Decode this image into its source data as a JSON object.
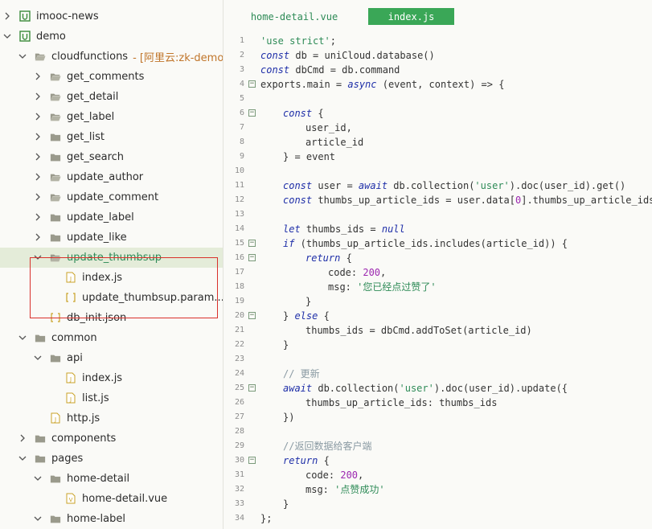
{
  "tree": {
    "rows": [
      {
        "label": "imooc-news",
        "depth": 0,
        "chevron": "right",
        "icon": "project"
      },
      {
        "label": "demo",
        "depth": 0,
        "chevron": "down",
        "icon": "project"
      },
      {
        "label": "cloudfunctions",
        "depth": 1,
        "chevron": "down",
        "icon": "folder-open",
        "suffix": "- [阿里云:zk-demo]"
      },
      {
        "label": "get_comments",
        "depth": 2,
        "chevron": "right",
        "icon": "folder-open"
      },
      {
        "label": "get_detail",
        "depth": 2,
        "chevron": "right",
        "icon": "folder-open"
      },
      {
        "label": "get_label",
        "depth": 2,
        "chevron": "right",
        "icon": "folder-open"
      },
      {
        "label": "get_list",
        "depth": 2,
        "chevron": "right",
        "icon": "folder"
      },
      {
        "label": "get_search",
        "depth": 2,
        "chevron": "right",
        "icon": "folder"
      },
      {
        "label": "update_author",
        "depth": 2,
        "chevron": "right",
        "icon": "folder-open"
      },
      {
        "label": "update_comment",
        "depth": 2,
        "chevron": "right",
        "icon": "folder-open"
      },
      {
        "label": "update_label",
        "depth": 2,
        "chevron": "right",
        "icon": "folder"
      },
      {
        "label": "update_like",
        "depth": 2,
        "chevron": "right",
        "icon": "folder"
      },
      {
        "label": "update_thumbsup",
        "depth": 2,
        "chevron": "down",
        "icon": "folder-open",
        "selected": true
      },
      {
        "label": "index.js",
        "depth": 3,
        "chevron": "none",
        "icon": "js-file"
      },
      {
        "label": "update_thumbsup.param....",
        "depth": 3,
        "chevron": "none",
        "icon": "json-file"
      },
      {
        "label": "db_init.json",
        "depth": 2,
        "chevron": "none",
        "icon": "json-file"
      },
      {
        "label": "common",
        "depth": 1,
        "chevron": "down",
        "icon": "folder"
      },
      {
        "label": "api",
        "depth": 2,
        "chevron": "down",
        "icon": "folder"
      },
      {
        "label": "index.js",
        "depth": 3,
        "chevron": "none",
        "icon": "js-file"
      },
      {
        "label": "list.js",
        "depth": 3,
        "chevron": "none",
        "icon": "js-file"
      },
      {
        "label": "http.js",
        "depth": 2,
        "chevron": "none",
        "icon": "js-file"
      },
      {
        "label": "components",
        "depth": 1,
        "chevron": "right",
        "icon": "folder"
      },
      {
        "label": "pages",
        "depth": 1,
        "chevron": "down",
        "icon": "folder"
      },
      {
        "label": "home-detail",
        "depth": 2,
        "chevron": "down",
        "icon": "folder"
      },
      {
        "label": "home-detail.vue",
        "depth": 3,
        "chevron": "none",
        "icon": "vue-file"
      },
      {
        "label": "home-label",
        "depth": 2,
        "chevron": "down",
        "icon": "folder"
      }
    ]
  },
  "tabs": [
    {
      "label": "home-detail.vue",
      "active": false
    },
    {
      "label": "index.js",
      "active": true
    }
  ],
  "colors": {
    "accent": "#3aa757",
    "highlight": "#d9302b",
    "selection": "#e4ecd9"
  },
  "code": [
    {
      "n": "1",
      "fold": false,
      "indent": 0,
      "tokens": [
        [
          "str",
          "'use strict'"
        ],
        [
          "p",
          ";"
        ]
      ]
    },
    {
      "n": "2",
      "fold": false,
      "indent": 0,
      "tokens": [
        [
          "kw",
          "const"
        ],
        [
          "p",
          " db = uniCloud.database()"
        ]
      ]
    },
    {
      "n": "3",
      "fold": false,
      "indent": 0,
      "tokens": [
        [
          "kw",
          "const"
        ],
        [
          "p",
          " dbCmd = db.command"
        ]
      ]
    },
    {
      "n": "4",
      "fold": true,
      "indent": 0,
      "tokens": [
        [
          "p",
          "exports.main = "
        ],
        [
          "kw",
          "async"
        ],
        [
          "p",
          " (event, context) => {"
        ]
      ]
    },
    {
      "n": "5",
      "fold": false,
      "indent": 0,
      "tokens": []
    },
    {
      "n": "6",
      "fold": true,
      "indent": 1,
      "tokens": [
        [
          "kw",
          "const"
        ],
        [
          "p",
          " {"
        ]
      ]
    },
    {
      "n": "7",
      "fold": false,
      "indent": 2,
      "tokens": [
        [
          "p",
          "user_id,"
        ]
      ]
    },
    {
      "n": "8",
      "fold": false,
      "indent": 2,
      "tokens": [
        [
          "p",
          "article_id"
        ]
      ]
    },
    {
      "n": "9",
      "fold": false,
      "indent": 1,
      "tokens": [
        [
          "p",
          "} = event"
        ]
      ]
    },
    {
      "n": "10",
      "fold": false,
      "indent": 0,
      "tokens": []
    },
    {
      "n": "11",
      "fold": false,
      "indent": 1,
      "tokens": [
        [
          "kw",
          "const"
        ],
        [
          "p",
          " user = "
        ],
        [
          "kw",
          "await"
        ],
        [
          "p",
          " db.collection("
        ],
        [
          "str",
          "'user'"
        ],
        [
          "p",
          ").doc(user_id).get()"
        ]
      ]
    },
    {
      "n": "12",
      "fold": false,
      "indent": 1,
      "tokens": [
        [
          "kw",
          "const"
        ],
        [
          "p",
          " thumbs_up_article_ids = user.data["
        ],
        [
          "num",
          "0"
        ],
        [
          "p",
          "].thumbs_up_article_ids"
        ]
      ]
    },
    {
      "n": "13",
      "fold": false,
      "indent": 0,
      "tokens": []
    },
    {
      "n": "14",
      "fold": false,
      "indent": 1,
      "tokens": [
        [
          "kw",
          "let"
        ],
        [
          "p",
          " thumbs_ids = "
        ],
        [
          "nul",
          "null"
        ]
      ]
    },
    {
      "n": "15",
      "fold": true,
      "indent": 1,
      "tokens": [
        [
          "kw",
          "if"
        ],
        [
          "p",
          " (thumbs_up_article_ids.includes(article_id)) {"
        ]
      ]
    },
    {
      "n": "16",
      "fold": true,
      "indent": 2,
      "tokens": [
        [
          "kw",
          "return"
        ],
        [
          "p",
          " {"
        ]
      ]
    },
    {
      "n": "17",
      "fold": false,
      "indent": 3,
      "tokens": [
        [
          "p",
          "code: "
        ],
        [
          "num",
          "200"
        ],
        [
          "p",
          ","
        ]
      ]
    },
    {
      "n": "18",
      "fold": false,
      "indent": 3,
      "tokens": [
        [
          "p",
          "msg: "
        ],
        [
          "str",
          "'您已经点过赞了'"
        ]
      ]
    },
    {
      "n": "19",
      "fold": false,
      "indent": 2,
      "tokens": [
        [
          "p",
          "}"
        ]
      ]
    },
    {
      "n": "20",
      "fold": true,
      "indent": 1,
      "tokens": [
        [
          "p",
          "} "
        ],
        [
          "kw",
          "else"
        ],
        [
          "p",
          " {"
        ]
      ]
    },
    {
      "n": "21",
      "fold": false,
      "indent": 2,
      "tokens": [
        [
          "p",
          "thumbs_ids = dbCmd.addToSet(article_id)"
        ]
      ]
    },
    {
      "n": "22",
      "fold": false,
      "indent": 1,
      "tokens": [
        [
          "p",
          "}"
        ]
      ]
    },
    {
      "n": "23",
      "fold": false,
      "indent": 0,
      "tokens": []
    },
    {
      "n": "24",
      "fold": false,
      "indent": 1,
      "tokens": [
        [
          "cm",
          "// 更新"
        ]
      ]
    },
    {
      "n": "25",
      "fold": true,
      "indent": 1,
      "tokens": [
        [
          "kw",
          "await"
        ],
        [
          "p",
          " db.collection("
        ],
        [
          "str",
          "'user'"
        ],
        [
          "p",
          ").doc(user_id).update({"
        ]
      ]
    },
    {
      "n": "26",
      "fold": false,
      "indent": 2,
      "tokens": [
        [
          "p",
          "thumbs_up_article_ids: thumbs_ids"
        ]
      ]
    },
    {
      "n": "27",
      "fold": false,
      "indent": 1,
      "tokens": [
        [
          "p",
          "})"
        ]
      ]
    },
    {
      "n": "28",
      "fold": false,
      "indent": 0,
      "tokens": []
    },
    {
      "n": "29",
      "fold": false,
      "indent": 1,
      "tokens": [
        [
          "cm",
          "//返回数据给客户端"
        ]
      ]
    },
    {
      "n": "30",
      "fold": true,
      "indent": 1,
      "tokens": [
        [
          "kw",
          "return"
        ],
        [
          "p",
          " {"
        ]
      ]
    },
    {
      "n": "31",
      "fold": false,
      "indent": 2,
      "tokens": [
        [
          "p",
          "code: "
        ],
        [
          "num",
          "200"
        ],
        [
          "p",
          ","
        ]
      ]
    },
    {
      "n": "32",
      "fold": false,
      "indent": 2,
      "tokens": [
        [
          "p",
          "msg: "
        ],
        [
          "str",
          "'点赞成功'"
        ]
      ]
    },
    {
      "n": "33",
      "fold": false,
      "indent": 1,
      "tokens": [
        [
          "p",
          "}"
        ]
      ]
    },
    {
      "n": "34",
      "fold": false,
      "indent": 0,
      "tokens": [
        [
          "p",
          "};"
        ]
      ]
    }
  ]
}
